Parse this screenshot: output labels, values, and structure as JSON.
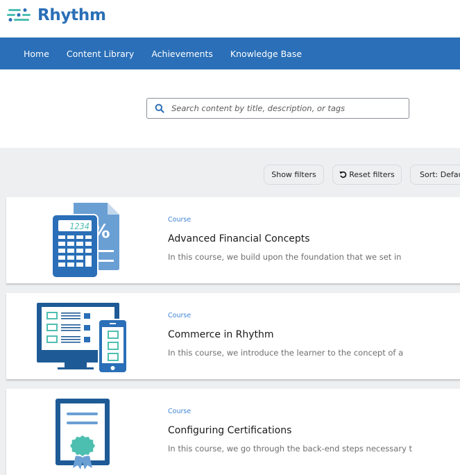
{
  "brand": {
    "name": "Rhythm",
    "color": "#2a6fb7",
    "accent": "#4dbfb0"
  },
  "nav": {
    "items": [
      {
        "label": "Home"
      },
      {
        "label": "Content Library"
      },
      {
        "label": "Achievements"
      },
      {
        "label": "Knowledge Base"
      }
    ]
  },
  "search": {
    "placeholder": "Search content by title, description, or tags",
    "value": "",
    "icon": "search-icon"
  },
  "toolbar": {
    "show_filters": "Show filters",
    "reset_filters": "Reset filters",
    "reset_icon": "undo-icon",
    "sort": "Sort: Default"
  },
  "courses": [
    {
      "type": "Course",
      "title": "Advanced Financial Concepts",
      "description": "In this course, we build upon the foundation that we set in",
      "thumbnail": "calculator-icon",
      "display_digits": "1234",
      "doc_symbol": "%"
    },
    {
      "type": "Course",
      "title": "Commerce in Rhythm",
      "description": "In this course, we introduce the learner to the concept of a",
      "thumbnail": "devices-icon"
    },
    {
      "type": "Course",
      "title": "Configuring Certifications",
      "description": "In this course, we go through the back-end steps necessary t",
      "thumbnail": "certificate-icon"
    }
  ]
}
